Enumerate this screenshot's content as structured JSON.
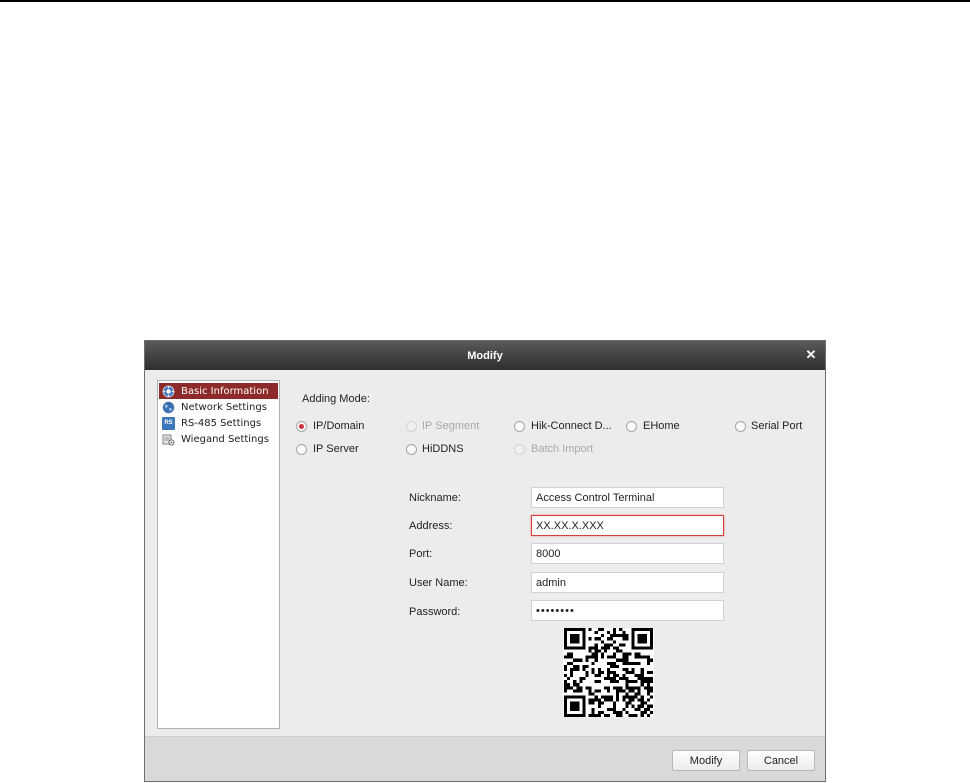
{
  "dialog": {
    "title": "Modify"
  },
  "sidebar": {
    "items": [
      {
        "label": "Basic Information",
        "icon": "gear-icon",
        "active": true
      },
      {
        "label": "Network Settings",
        "icon": "globe-icon"
      },
      {
        "label": "RS-485 Settings",
        "icon": "rs-icon",
        "badge": "RS"
      },
      {
        "label": "Wiegand Settings",
        "icon": "wiegand-icon"
      }
    ]
  },
  "adding_mode": {
    "label": "Adding Mode:",
    "options": [
      {
        "label": "IP/Domain",
        "checked": true,
        "enabled": true
      },
      {
        "label": "IP Segment",
        "checked": false,
        "enabled": false
      },
      {
        "label": "Hik-Connect D...",
        "checked": false,
        "enabled": true
      },
      {
        "label": "EHome",
        "checked": false,
        "enabled": true
      },
      {
        "label": "Serial Port",
        "checked": false,
        "enabled": true
      },
      {
        "label": "IP Server",
        "checked": false,
        "enabled": true
      },
      {
        "label": "HiDDNS",
        "checked": false,
        "enabled": true
      },
      {
        "label": "Batch Import",
        "checked": false,
        "enabled": false
      }
    ]
  },
  "form": {
    "nickname": {
      "label": "Nickname:",
      "value": "Access Control Terminal"
    },
    "address": {
      "label": "Address:",
      "value": "XX.XX.X.XXX"
    },
    "port": {
      "label": "Port:",
      "value": "8000"
    },
    "username": {
      "label": "User Name:",
      "value": "admin"
    },
    "password": {
      "label": "Password:",
      "value": "••••••••"
    }
  },
  "buttons": {
    "modify": "Modify",
    "cancel": "Cancel"
  },
  "colors": {
    "accent": "#8e2a2a",
    "error_border": "#d63e3e",
    "radio_checked": "#d0303d"
  }
}
